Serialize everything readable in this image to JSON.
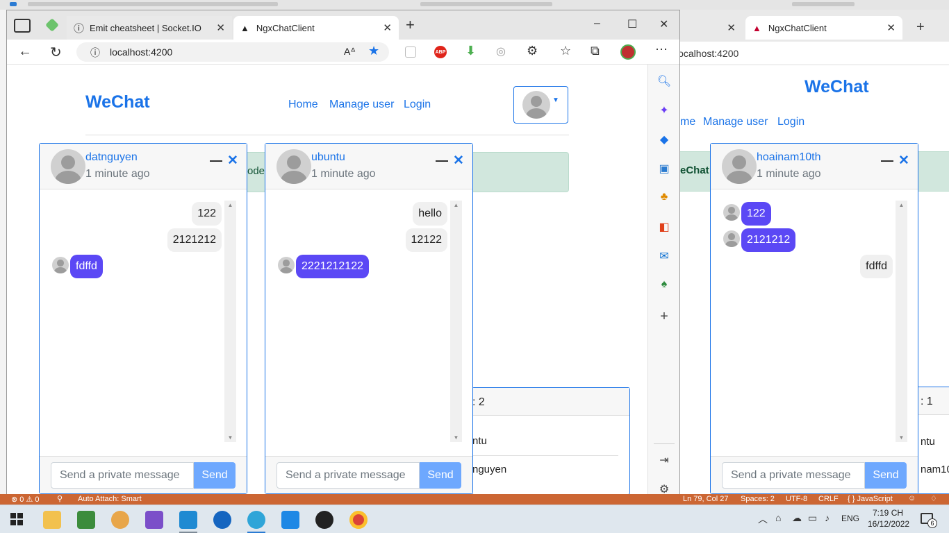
{
  "background_window": {
    "tabs": [
      {
        "label": ""
      },
      {
        "label": "NgxChatClient"
      }
    ],
    "address": "localhost:4200",
    "brand": "WeChat",
    "nav": [
      "me",
      "Manage user",
      "Login"
    ],
    "alert_fragment": "eChat",
    "online_header_fragment": ": 1",
    "online_items": [
      "ntu",
      "nam10"
    ],
    "chat": {
      "name": "hoainam10th",
      "time": "1 minute ago",
      "messages": [
        {
          "text": "122",
          "from": "them"
        },
        {
          "text": "2121212",
          "from": "them"
        },
        {
          "text": "fdffd",
          "from": "me"
        }
      ],
      "placeholder": "Send a private message",
      "send_label": "Send"
    }
  },
  "browser": {
    "tabs": [
      {
        "label": "Emit cheatsheet | Socket.IO"
      },
      {
        "label": "NgxChatClient"
      }
    ],
    "address": "localhost:4200",
    "window_controls": [
      "–",
      "☐",
      "✕"
    ]
  },
  "app": {
    "brand": "WeChat",
    "nav": [
      {
        "label": "Home"
      },
      {
        "label": "Manage user"
      },
      {
        "label": "Login"
      }
    ],
    "alert_fragment": "ode.",
    "online_header_fragment": ": 2",
    "online_items": [
      "ntu",
      "nguyen"
    ]
  },
  "chats": [
    {
      "name": "datnguyen",
      "time": "1 minute ago",
      "messages": [
        {
          "text": "122",
          "from": "me"
        },
        {
          "text": "2121212",
          "from": "me"
        },
        {
          "text": "fdffd",
          "from": "them"
        }
      ],
      "placeholder": "Send a private message",
      "send_label": "Send"
    },
    {
      "name": "ubuntu",
      "time": "1 minute ago",
      "messages": [
        {
          "text": "hello",
          "from": "me"
        },
        {
          "text": "12122",
          "from": "me"
        },
        {
          "text": "2221212122",
          "from": "them"
        }
      ],
      "placeholder": "Send a private message",
      "send_label": "Send"
    }
  ],
  "statusbar": {
    "left": "⊗ 0 ⚠ 0",
    "attach": "Auto Attach: Smart",
    "position": "Ln 79, Col 27",
    "spaces": "Spaces: 2",
    "encoding": "UTF-8",
    "eol": "CRLF",
    "language": "{ } JavaScript"
  },
  "taskbar": {
    "lang": "ENG",
    "time": "7:19 CH",
    "date": "16/12/2022",
    "notifications": "6"
  },
  "colors": {
    "link": "#1a73e8",
    "bubble_them": "#5b48f5",
    "send_button": "#6ea8fe",
    "statusbar": "#cc6633",
    "alert_bg": "#d1e7dd"
  }
}
